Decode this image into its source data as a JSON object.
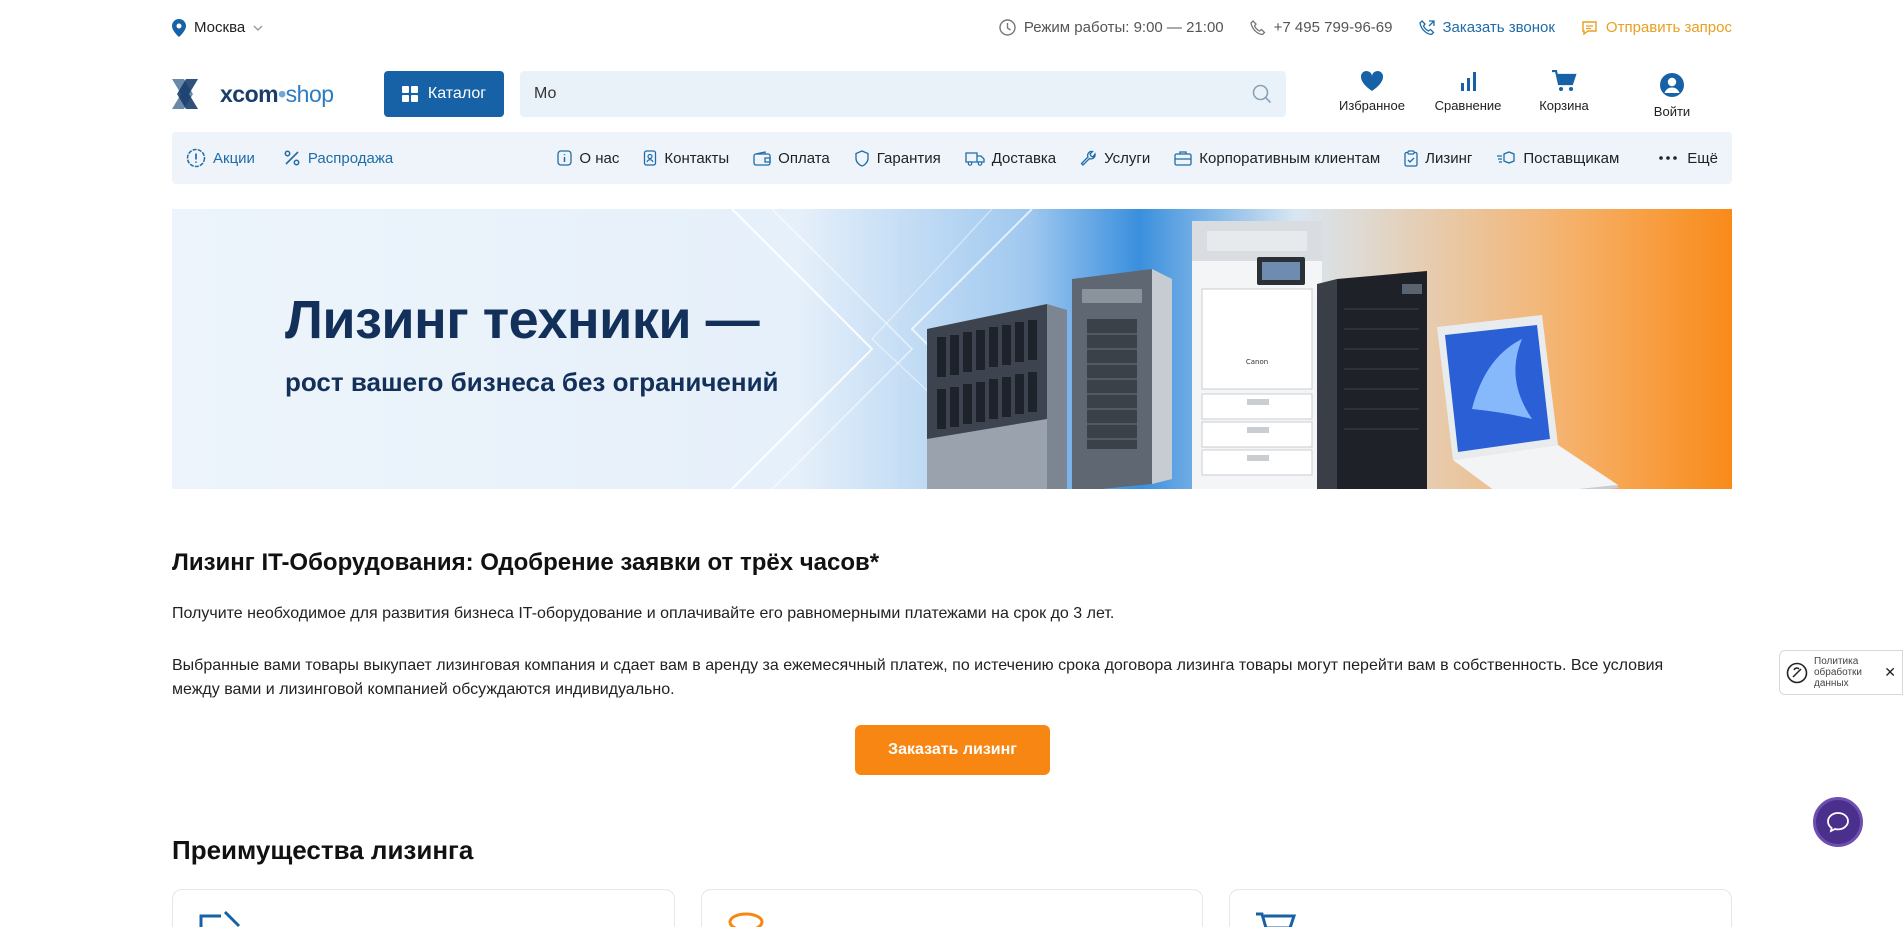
{
  "topbar": {
    "city": "Москва",
    "hours": "Режим работы: 9:00 — 21:00",
    "phone": "+7 495 799-96-69",
    "callback": "Заказать звонок",
    "request": "Отправить запрос"
  },
  "header": {
    "logo_main": "xcom",
    "logo_dot": "•",
    "logo_shop": "shop",
    "catalog": "Каталог",
    "search_value": "Мо",
    "favorites": "Избранное",
    "compare": "Сравнение",
    "cart": "Корзина",
    "login": "Войти"
  },
  "nav": {
    "left": [
      "Акции",
      "Распродажа"
    ],
    "items": [
      "О нас",
      "Контакты",
      "Оплата",
      "Гарантия",
      "Доставка",
      "Услуги",
      "Корпоративным клиентам",
      "Лизинг",
      "Поставщикам"
    ],
    "more": "Ещё"
  },
  "banner": {
    "title": "Лизинг техники —",
    "subtitle": "рост вашего бизнеса без ограничений",
    "brand": "Canon"
  },
  "main": {
    "title": "Лизинг IT-Оборудования: Одобрение заявки от трёх часов*",
    "p1": "Получите необходимое для развития бизнеса IT-оборудование и оплачивайте его равномерными платежами на срок до 3 лет.",
    "p2": "Выбранные вами товары выкупает лизинговая компания и сдает вам в аренду за ежемесячный платеж, по истечению срока договора лизинга товары могут перейти вам в собственность. Все условия между вами и лизинговой компанией обсуждаются индивидуально.",
    "order_button": "Заказать лизинг",
    "advantages_title": "Преимущества лизинга"
  },
  "policy": {
    "line1": "Политика",
    "line2": "обработки",
    "line3": "данных",
    "close": "✕"
  },
  "colors": {
    "primary": "#1762a7",
    "accent": "#f78612",
    "nav_bg": "#eef4fa",
    "chat": "#4b2f8c"
  }
}
